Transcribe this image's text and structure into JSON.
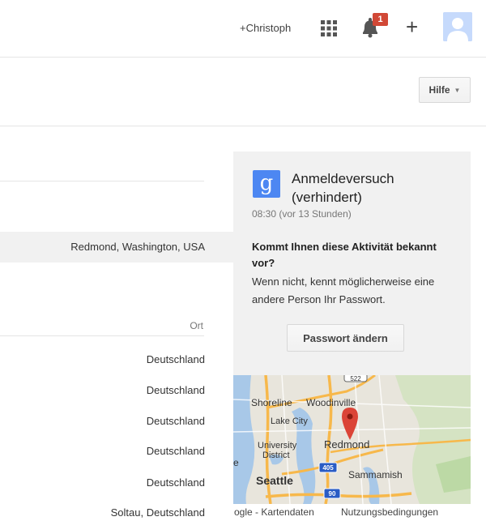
{
  "header": {
    "user_link": "+Christoph",
    "notification_count": "1",
    "plus_label": "+"
  },
  "toolbar": {
    "help_label": "Hilfe",
    "help_caret": "▼"
  },
  "highlighted_location": "Redmond, Washington, USA",
  "table": {
    "column_header": "Ort",
    "rows": [
      "Deutschland",
      "Deutschland",
      "Deutschland",
      "Deutschland",
      "Deutschland",
      "Soltau, Deutschland"
    ]
  },
  "event": {
    "logo_letter": "g",
    "title": "Anmeldeversuch (verhindert)",
    "time": "08:30 (vor 13 Stunden)",
    "question": "Kommt Ihnen diese Aktivität bekannt vor?",
    "explanation": "Wenn nicht, kennt möglicherweise eine andere Person Ihr Passwort.",
    "button_label": "Passwort ändern"
  },
  "map": {
    "labels": {
      "shoreline": "Shoreline",
      "woodinville": "Woodinville",
      "lake_city": "Lake City",
      "university_district": "University District",
      "redmond": "Redmond",
      "seattle": "Seattle",
      "sammamish": "Sammamish",
      "hw522": "522",
      "hw405": "405",
      "hw90": "90",
      "edge_letter": "e"
    },
    "footer": {
      "data": "ogle - Kartendaten",
      "terms": "Nutzungsbedingungen"
    }
  },
  "colors": {
    "accent_blue": "#4d87f2",
    "badge_red": "#d14836",
    "marker_red": "#db4437"
  }
}
